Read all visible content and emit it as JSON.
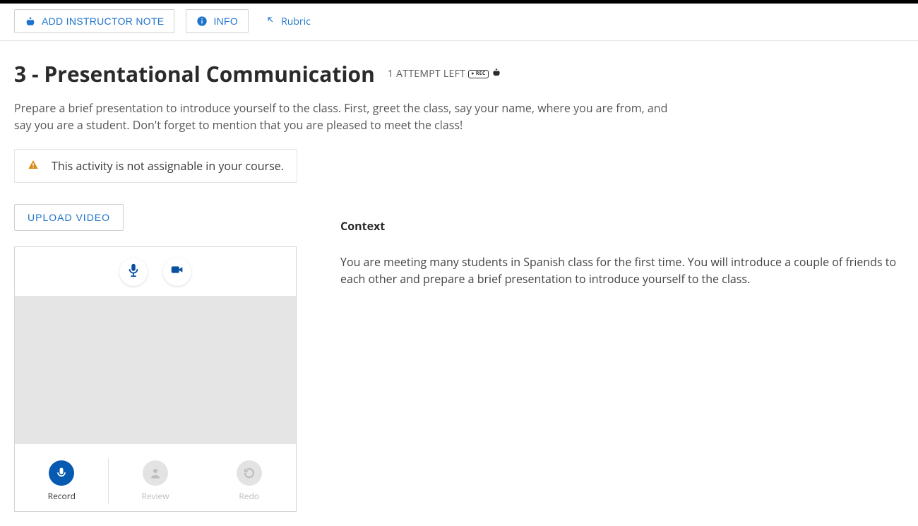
{
  "toolbar": {
    "add_note_label": "ADD INSTRUCTOR NOTE",
    "info_label": "INFO",
    "rubric_label": "Rubric"
  },
  "activity": {
    "title": "3 - Presentational Communication",
    "attempts_text": "1 ATTEMPT LEFT",
    "rec_badge": "● REC",
    "description": "Prepare a brief presentation to introduce yourself to the class. First, greet the class, say your name, where you are from, and say you are a student. Don't forget to mention that you are pleased to meet the class!"
  },
  "warning": {
    "text": "This activity is not assignable in your course."
  },
  "upload_label": "UPLOAD VIDEO",
  "context": {
    "heading": "Context",
    "body": "You are meeting many students in Spanish class for the first time. You will introduce a couple of friends to each other and prepare a brief presentation to introduce yourself to the class."
  },
  "recorder": {
    "controls": {
      "record": "Record",
      "review": "Review",
      "redo": "Redo"
    }
  },
  "colors": {
    "accent": "#1e73cc",
    "record_active": "#065ab2"
  }
}
